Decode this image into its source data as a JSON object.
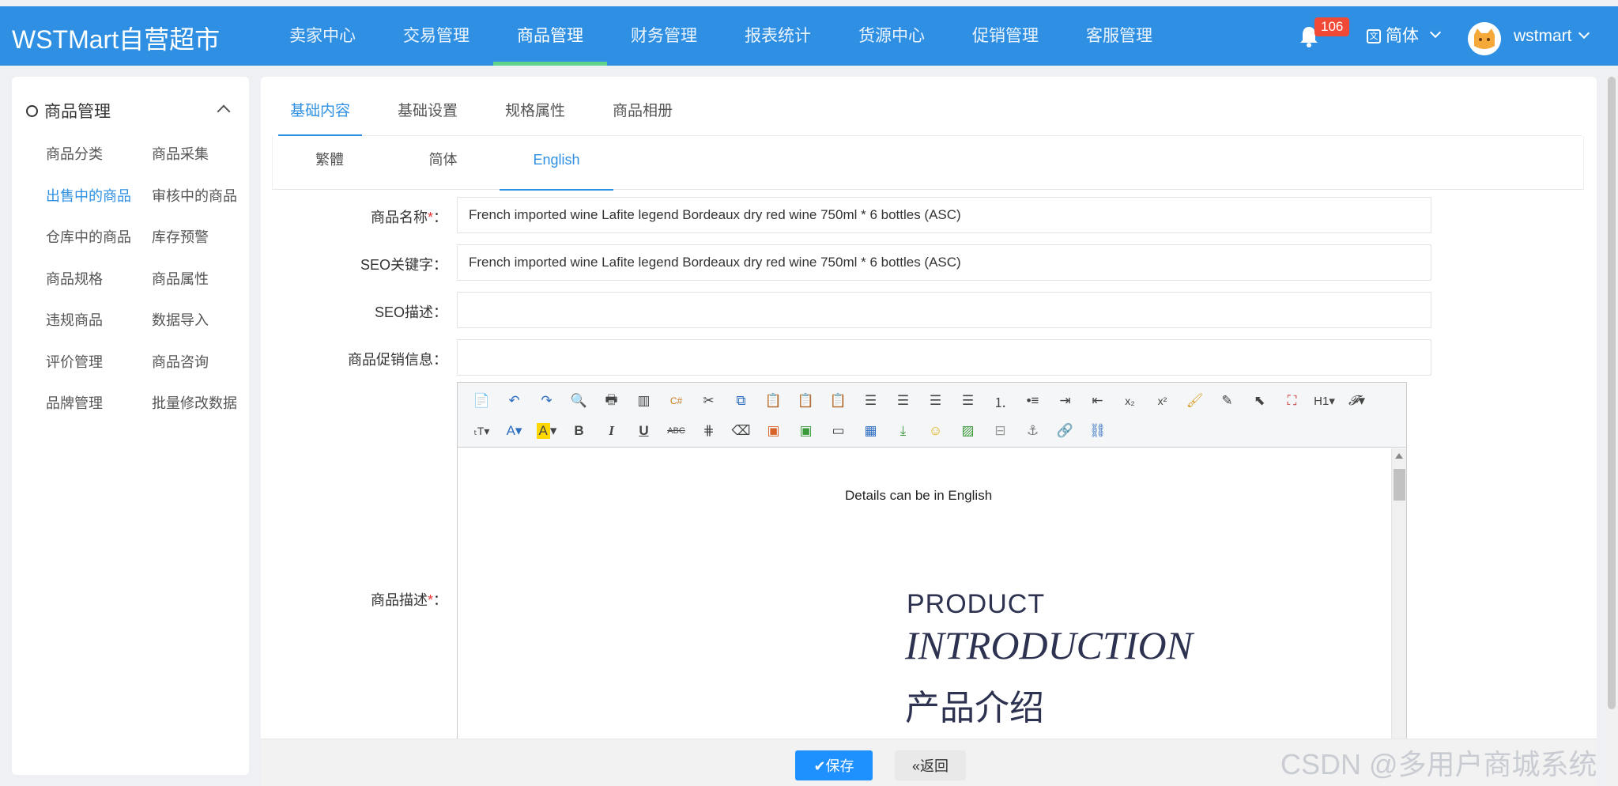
{
  "header": {
    "logo": "WSTMart自营超市",
    "nav": [
      "卖家中心",
      "交易管理",
      "商品管理",
      "财务管理",
      "报表统计",
      "货源中心",
      "促销管理",
      "客服管理"
    ],
    "nav_active": "商品管理",
    "notification_count": "106",
    "language": "简体",
    "username": "wstmart"
  },
  "sidebar": {
    "title": "商品管理",
    "items": [
      "商品分类",
      "商品采集",
      "出售中的商品",
      "审核中的商品",
      "仓库中的商品",
      "库存预警",
      "商品规格",
      "商品属性",
      "违规商品",
      "数据导入",
      "评价管理",
      "商品咨询",
      "品牌管理",
      "批量修改数据"
    ],
    "active": "出售中的商品"
  },
  "tabs": [
    "基础内容",
    "基础设置",
    "规格属性",
    "商品相册"
  ],
  "lang_tabs": [
    "繁體",
    "简体",
    "English"
  ],
  "form": {
    "name_label": "商品名称",
    "name_value": "French imported wine Lafite legend Bordeaux dry red wine 750ml * 6 bottles (ASC)",
    "seo_keywords_label": "SEO关键字：",
    "seo_keywords_value": "French imported wine Lafite legend Bordeaux dry red wine 750ml * 6 bottles (ASC)",
    "seo_desc_label": "SEO描述：",
    "seo_desc_value": "",
    "promo_label": "商品促销信息：",
    "promo_value": "",
    "desc_label": "商品描述",
    "colon": "："
  },
  "editor": {
    "details_text": "Details can be in English",
    "image_text_1": "PRODUCT",
    "image_text_2": "INTRODUCTION",
    "image_text_3": "产品介绍"
  },
  "actions": {
    "save": "✔保存",
    "back": "«返回"
  },
  "watermark": "CSDN @多用户商城系统",
  "colors": {
    "brand": "#2f90e3",
    "active_underline": "#5fd38b",
    "badge": "#f04a36",
    "save_button": "#1e90ff"
  }
}
